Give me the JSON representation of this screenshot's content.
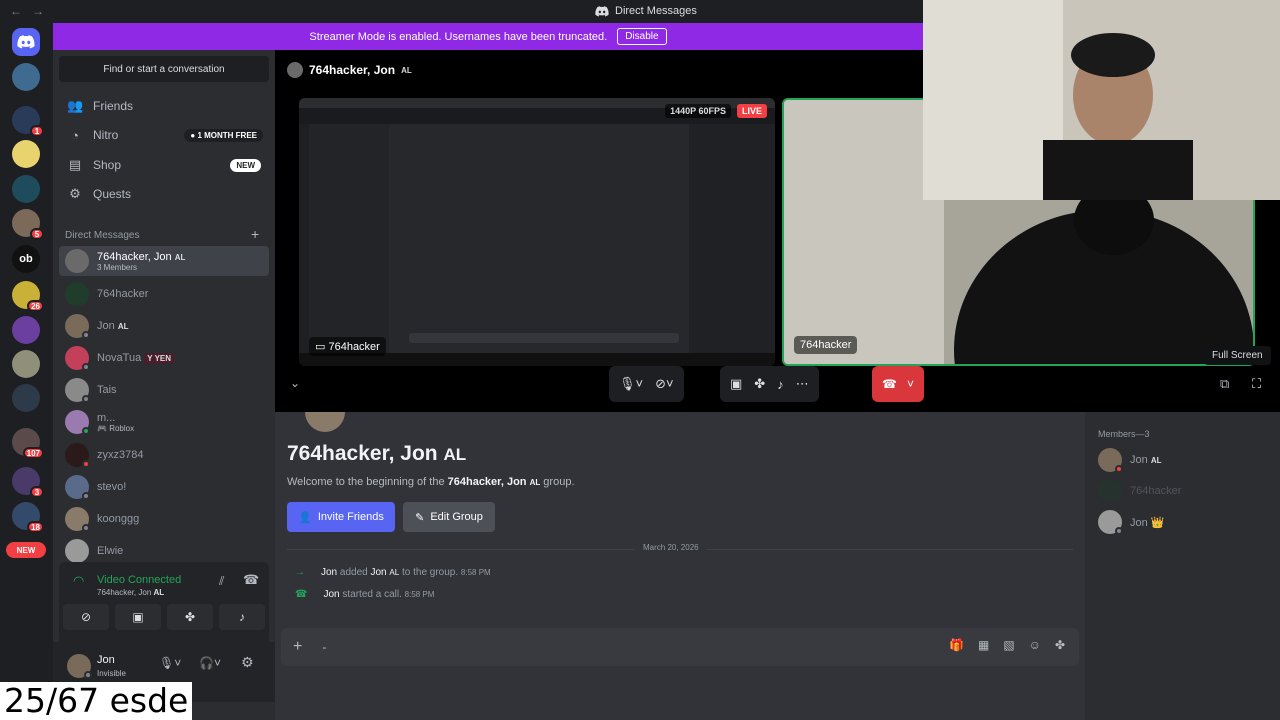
{
  "window": {
    "title": "Direct Messages",
    "nav": [
      "←",
      "→"
    ]
  },
  "banner": {
    "text": "Streamer Mode is enabled. Usernames have been truncated.",
    "button": "Disable"
  },
  "rail": {
    "badges": [
      "1",
      "5",
      "26",
      "107",
      "3",
      "18"
    ],
    "ob_label": "ob",
    "new_label": "NEW"
  },
  "sidebar": {
    "search": "Find or start a conversation",
    "nav": [
      {
        "label": "Friends",
        "icon": "friends-icon"
      },
      {
        "label": "Nitro",
        "icon": "nitro-icon",
        "pill": "1 MONTH FREE"
      },
      {
        "label": "Shop",
        "icon": "shop-icon",
        "pill": "NEW"
      },
      {
        "label": "Quests",
        "icon": "quests-icon"
      }
    ],
    "dm_header": "Direct Messages",
    "dms": [
      {
        "name": "764hacker, Jon",
        "tag": "AL",
        "sub": "3 Members"
      },
      {
        "name": "764hacker"
      },
      {
        "name": "Jon",
        "tag": "AL"
      },
      {
        "name": "NovaTua",
        "tag": "YEN"
      },
      {
        "name": "Tais"
      },
      {
        "name": "m...",
        "sub": "Roblox"
      },
      {
        "name": "zyxz3784"
      },
      {
        "name": "stevo!"
      },
      {
        "name": "koonggg"
      },
      {
        "name": "Elwie"
      }
    ]
  },
  "voice": {
    "status": "Video Connected",
    "channel": "764hacker, Jon",
    "channel_tag": "AL"
  },
  "user": {
    "name": "Jon",
    "status": "Invisible"
  },
  "call": {
    "title": "764hacker, Jon",
    "title_tag": "AL",
    "stream_name": "764hacker",
    "quality": "1440P 60FPS",
    "live": "LIVE",
    "cam_name": "764hacker",
    "tooltip": "Full Screen"
  },
  "chat": {
    "title": "764hacker, Jon",
    "title_tag": "AL",
    "welcome_pre": "Welcome to the beginning of the ",
    "welcome_bold": "764hacker, Jon",
    "welcome_tag": "AL",
    "welcome_post": " group.",
    "invite": "Invite Friends",
    "edit": "Edit Group",
    "date": "March 20, 2026",
    "messages": [
      {
        "actor": "Jon",
        "text": "added",
        "target": "Jon",
        "target_tag": "AL",
        "rest": "to the group.",
        "time": "8:58 PM"
      },
      {
        "actor": "Jon",
        "text": "started a call.",
        "time": "8:58 PM"
      }
    ],
    "composer_placeholder": "-"
  },
  "members": {
    "header": "Members—3",
    "list": [
      {
        "name": "Jon",
        "tag": "AL"
      },
      {
        "name": "764hacker"
      },
      {
        "name": "Jon",
        "crown": "👑"
      }
    ]
  },
  "overlay": "25/67 esde",
  "colors": {
    "blurple": "#5865f2",
    "banner": "#8f29e6",
    "danger": "#da373c",
    "green": "#23a559"
  }
}
